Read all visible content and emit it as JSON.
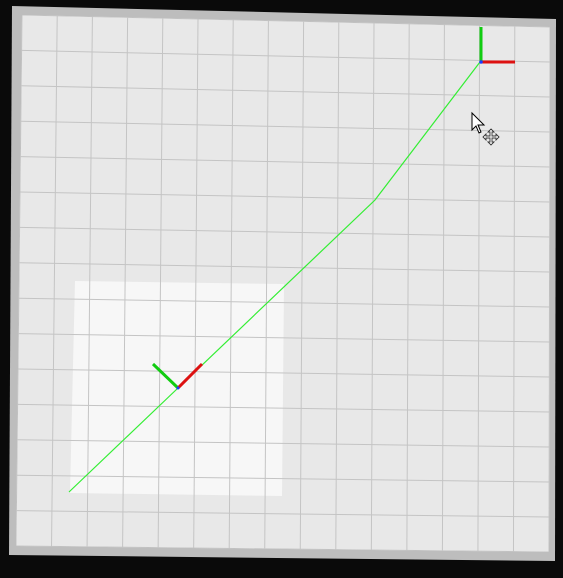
{
  "scene": {
    "background_color": "#0a0a0a",
    "map_outer_color": "#bdbdbd",
    "map_inner_color": "#e8e8e8",
    "region_highlight_color": "#f7f7f7",
    "grid_color": "#c4c4c4",
    "path_color": "#33ee33",
    "axis_x_color": "#dd1111",
    "axis_y_color": "#11cc11",
    "axis_z_color": "#1a3cff"
  },
  "objects": {
    "start_frame_icon": "coordinate-axes-icon",
    "goal_frame_icon": "coordinate-axes-icon",
    "cursor_icon": "arrow-pointer-icon",
    "move_icon": "move-cross-icon"
  }
}
